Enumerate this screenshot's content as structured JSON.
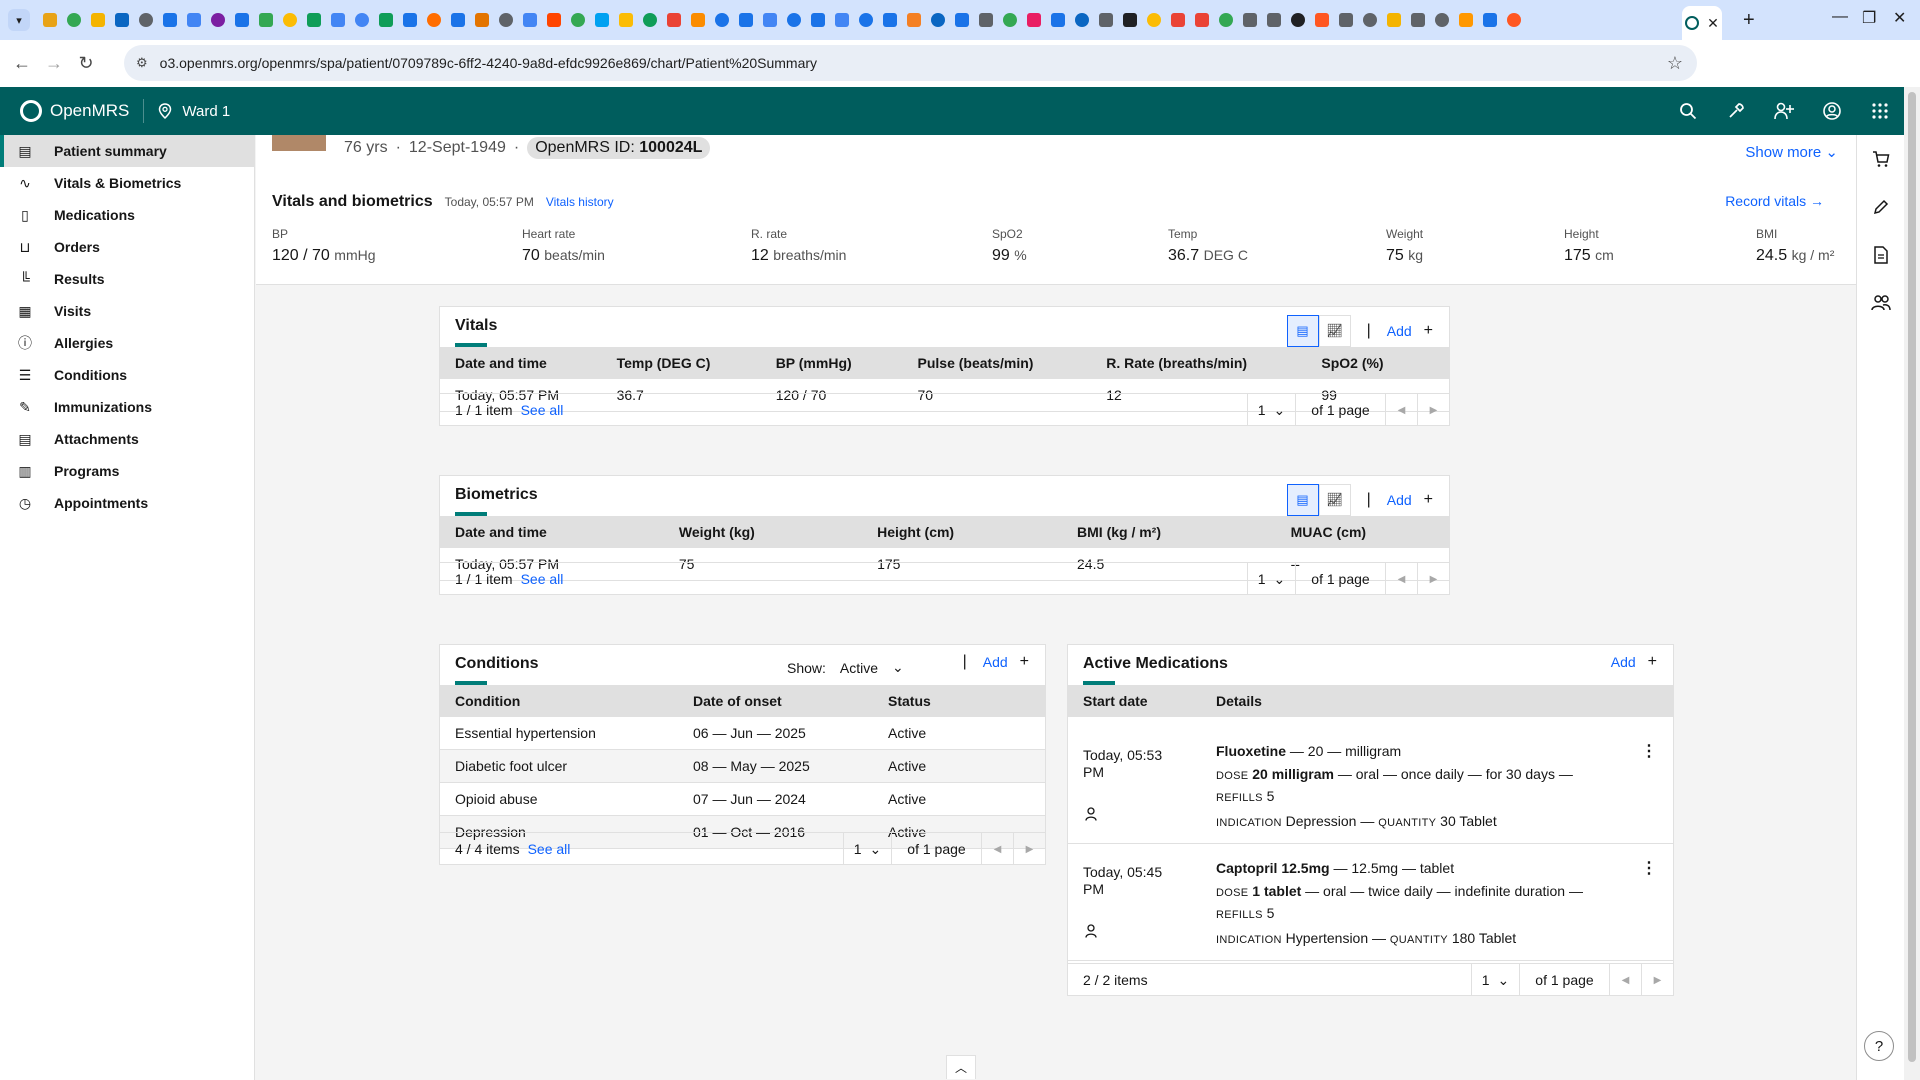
{
  "browser": {
    "url": "o3.openmrs.org/openmrs/spa/patient/0709789c-6ff2-4240-9a8d-efdc9926e869/chart/Patient%20Summary",
    "favicon_colors": [
      "#e8a317",
      "#34a853",
      "#f4b400",
      "#0a66c2",
      "#5f6368",
      "#1a73e8",
      "#4285f4",
      "#7b1fa2",
      "#1a73e8",
      "#34a853",
      "#fbbc05",
      "#0f9d58",
      "#4285f4",
      "#4285f4",
      "#0f9d58",
      "#1a73e8",
      "#ff6d00",
      "#1a73e8",
      "#e37400",
      "#5f6368",
      "#4285f4",
      "#ff4500",
      "#34a853",
      "#00a1f1",
      "#fbbc05",
      "#0f9d58",
      "#ea4335",
      "#fb8c00",
      "#1a73e8",
      "#1a73e8",
      "#4285f4",
      "#1a73e8",
      "#1a73e8",
      "#4285f4",
      "#1a73e8",
      "#1a73e8",
      "#f48024",
      "#0a66c2",
      "#1a73e8",
      "#5f6368",
      "#34a853",
      "#e91e63",
      "#1a73e8",
      "#0a66c2",
      "#5f6368",
      "#202124",
      "#fbbc05",
      "#ea4335",
      "#ea4335",
      "#34a853",
      "#5f6368",
      "#5f6368",
      "#202124",
      "#ff5722",
      "#5f6368",
      "#5f6368",
      "#f4b400",
      "#5f6368",
      "#5f6368",
      "#ff9800",
      "#1a73e8",
      "#ff5722"
    ]
  },
  "header": {
    "brand": "OpenMRS",
    "location": "Ward 1"
  },
  "nav": {
    "items": [
      {
        "label": "Patient summary",
        "icon": "summary-icon"
      },
      {
        "label": "Vitals & Biometrics",
        "icon": "activity-icon"
      },
      {
        "label": "Medications",
        "icon": "medication-icon"
      },
      {
        "label": "Orders",
        "icon": "cart-icon"
      },
      {
        "label": "Results",
        "icon": "chart-icon"
      },
      {
        "label": "Visits",
        "icon": "calendar-icon"
      },
      {
        "label": "Allergies",
        "icon": "warning-icon"
      },
      {
        "label": "Conditions",
        "icon": "list-checked-icon"
      },
      {
        "label": "Immunizations",
        "icon": "syringe-icon"
      },
      {
        "label": "Attachments",
        "icon": "document-icon"
      },
      {
        "label": "Programs",
        "icon": "programs-icon"
      },
      {
        "label": "Appointments",
        "icon": "appointment-icon"
      }
    ]
  },
  "banner": {
    "age": "76 yrs",
    "dob": "12-Sept-1949",
    "id_label": "OpenMRS ID:",
    "id_value": "100024L",
    "show_more": "Show more"
  },
  "vitals_header": {
    "title": "Vitals and biometrics",
    "time": "Today, 05:57 PM",
    "history_link": "Vitals history",
    "record": "Record vitals",
    "items": [
      {
        "label": "BP",
        "value": "120 / 70",
        "unit": "mmHg"
      },
      {
        "label": "Heart rate",
        "value": "70",
        "unit": "beats/min"
      },
      {
        "label": "R. rate",
        "value": "12",
        "unit": "breaths/min"
      },
      {
        "label": "SpO2",
        "value": "99",
        "unit": "%"
      },
      {
        "label": "Temp",
        "value": "36.7",
        "unit": "DEG C"
      },
      {
        "label": "Weight",
        "value": "75",
        "unit": "kg"
      },
      {
        "label": "Height",
        "value": "175",
        "unit": "cm"
      },
      {
        "label": "BMI",
        "value": "24.5",
        "unit": "kg / m²"
      }
    ]
  },
  "vitals_card": {
    "title": "Vitals",
    "add": "Add",
    "columns": [
      "Date and time",
      "Temp (DEG C)",
      "BP (mmHg)",
      "Pulse (beats/min)",
      "R. Rate (breaths/min)",
      "SpO2 (%)"
    ],
    "rows": [
      [
        "Today, 05:57 PM",
        "36.7",
        "120 / 70",
        "70",
        "12",
        "99"
      ]
    ],
    "count": "1 / 1 item",
    "see_all": "See all",
    "page": "1",
    "of_pages": "of 1 page"
  },
  "biometrics_card": {
    "title": "Biometrics",
    "add": "Add",
    "columns": [
      "Date and time",
      "Weight (kg)",
      "Height (cm)",
      "BMI (kg / m²)",
      "MUAC (cm)"
    ],
    "rows": [
      [
        "Today, 05:57 PM",
        "75",
        "175",
        "24.5",
        "--"
      ]
    ],
    "count": "1 / 1 item",
    "see_all": "See all",
    "page": "1",
    "of_pages": "of 1 page"
  },
  "conditions_card": {
    "title": "Conditions",
    "show_label": "Show:",
    "show_value": "Active",
    "add": "Add",
    "columns": [
      "Condition",
      "Date of onset",
      "Status"
    ],
    "rows": [
      [
        "Essential hypertension",
        "06 — Jun — 2025",
        "Active"
      ],
      [
        "Diabetic foot ulcer",
        "08 — May — 2025",
        "Active"
      ],
      [
        "Opioid abuse",
        "07 — Jun — 2024",
        "Active"
      ],
      [
        "Depression",
        "01 — Oct — 2016",
        "Active"
      ]
    ],
    "count": "4 / 4 items",
    "see_all": "See all",
    "page": "1",
    "of_pages": "of 1 page"
  },
  "medications_card": {
    "title": "Active Medications",
    "add": "Add",
    "columns": [
      "Start date",
      "Details"
    ],
    "items": [
      {
        "date": "Today, 05:53 PM",
        "name": "Fluoxetine",
        "name_rest": " — 20 — milligram",
        "dose_label": "DOSE",
        "dose": "20 milligram",
        "dose_rest": " — oral — once daily — for 30 days —",
        "refills_label": "REFILLS",
        "refills": "5",
        "indication_label": "INDICATION",
        "indication": "Depression",
        "quantity_label": "QUANTITY",
        "quantity": "30 Tablet"
      },
      {
        "date": "Today, 05:45 PM",
        "name": "Captopril 12.5mg",
        "name_rest": " — 12.5mg — tablet",
        "dose_label": "DOSE",
        "dose": "1 tablet",
        "dose_rest": " — oral — twice daily — indefinite duration —",
        "refills_label": "REFILLS",
        "refills": "5",
        "indication_label": "INDICATION",
        "indication": "Hypertension",
        "quantity_label": "QUANTITY",
        "quantity": "180 Tablet"
      }
    ],
    "count": "2 / 2 items",
    "page": "1",
    "of_pages": "of 1 page"
  },
  "colors": {
    "brand": "#005d5d",
    "accent": "#007d79",
    "link": "#0f62fe"
  }
}
